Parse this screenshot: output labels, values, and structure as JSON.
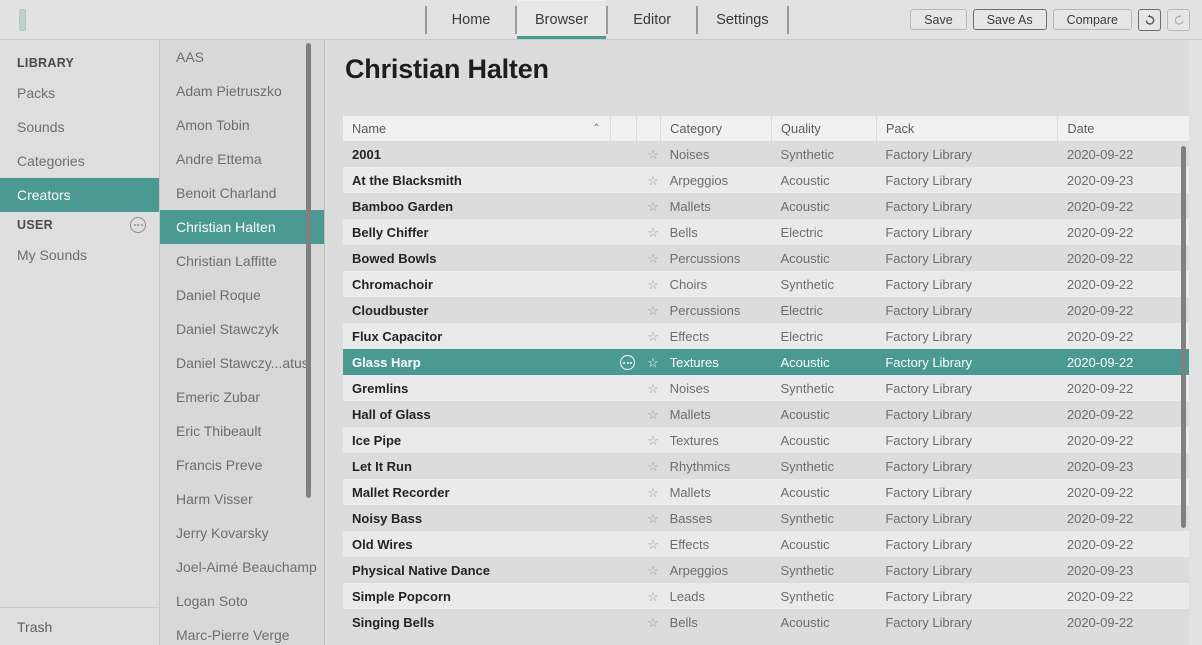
{
  "app": {
    "accent_color": "#4a9a93",
    "logo_name": "app-logo"
  },
  "topbar": {
    "tabs": [
      {
        "label": "Home",
        "active": false
      },
      {
        "label": "Browser",
        "active": true
      },
      {
        "label": "Editor",
        "active": false
      },
      {
        "label": "Settings",
        "active": false
      }
    ],
    "actions": {
      "save_label": "Save",
      "save_as_label": "Save As",
      "compare_label": "Compare",
      "undo_icon": "undo-icon",
      "redo_icon": "redo-icon"
    }
  },
  "sidebar": {
    "sections": [
      {
        "title": "LIBRARY",
        "has_menu": false,
        "items": [
          {
            "label": "Packs",
            "selected": false
          },
          {
            "label": "Sounds",
            "selected": false
          },
          {
            "label": "Categories",
            "selected": false
          },
          {
            "label": "Creators",
            "selected": true
          }
        ]
      },
      {
        "title": "USER",
        "has_menu": true,
        "menu_icon": "more-options-icon",
        "items": [
          {
            "label": "My Sounds",
            "selected": false
          }
        ]
      }
    ],
    "footer": {
      "label": "Trash"
    }
  },
  "creators": {
    "items": [
      {
        "label": "AAS",
        "selected": false
      },
      {
        "label": "Adam Pietruszko",
        "selected": false
      },
      {
        "label": "Amon Tobin",
        "selected": false
      },
      {
        "label": "Andre Ettema",
        "selected": false
      },
      {
        "label": "Benoit Charland",
        "selected": false
      },
      {
        "label": "Christian Halten",
        "selected": true
      },
      {
        "label": "Christian Laffitte",
        "selected": false
      },
      {
        "label": "Daniel Roque",
        "selected": false
      },
      {
        "label": "Daniel Stawczyk",
        "selected": false
      },
      {
        "label": "Daniel Stawczy...atus",
        "selected": false
      },
      {
        "label": "Emeric Zubar",
        "selected": false
      },
      {
        "label": "Eric Thibeault",
        "selected": false
      },
      {
        "label": "Francis Preve",
        "selected": false
      },
      {
        "label": "Harm Visser",
        "selected": false
      },
      {
        "label": "Jerry Kovarsky",
        "selected": false
      },
      {
        "label": "Joel-Aimé Beauchamp",
        "selected": false
      },
      {
        "label": "Logan Soto",
        "selected": false
      },
      {
        "label": "Marc-Pierre Verge",
        "selected": false
      }
    ]
  },
  "main": {
    "title": "Christian Halten",
    "table": {
      "columns": [
        {
          "key": "name",
          "label": "Name",
          "sort": "asc"
        },
        {
          "key": "dots",
          "label": "",
          "sort": null
        },
        {
          "key": "star",
          "label": "",
          "sort": null
        },
        {
          "key": "category",
          "label": "Category",
          "sort": null
        },
        {
          "key": "quality",
          "label": "Quality",
          "sort": null
        },
        {
          "key": "pack",
          "label": "Pack",
          "sort": null
        },
        {
          "key": "date",
          "label": "Date",
          "sort": null
        }
      ],
      "sort_caret_glyph": "⌃",
      "star_glyph": "☆",
      "rows": [
        {
          "name": "2001",
          "category": "Noises",
          "quality": "Synthetic",
          "pack": "Factory Library",
          "date": "2020-09-22",
          "selected": false,
          "starred": false,
          "has_dots": false
        },
        {
          "name": "At the Blacksmith",
          "category": "Arpeggios",
          "quality": "Acoustic",
          "pack": "Factory Library",
          "date": "2020-09-23",
          "selected": false,
          "starred": false,
          "has_dots": false
        },
        {
          "name": "Bamboo Garden",
          "category": "Mallets",
          "quality": "Acoustic",
          "pack": "Factory Library",
          "date": "2020-09-22",
          "selected": false,
          "starred": false,
          "has_dots": false
        },
        {
          "name": "Belly Chiffer",
          "category": "Bells",
          "quality": "Electric",
          "pack": "Factory Library",
          "date": "2020-09-22",
          "selected": false,
          "starred": false,
          "has_dots": false
        },
        {
          "name": "Bowed Bowls",
          "category": "Percussions",
          "quality": "Acoustic",
          "pack": "Factory Library",
          "date": "2020-09-22",
          "selected": false,
          "starred": false,
          "has_dots": false
        },
        {
          "name": "Chromachoir",
          "category": "Choirs",
          "quality": "Synthetic",
          "pack": "Factory Library",
          "date": "2020-09-22",
          "selected": false,
          "starred": false,
          "has_dots": false
        },
        {
          "name": "Cloudbuster",
          "category": "Percussions",
          "quality": "Electric",
          "pack": "Factory Library",
          "date": "2020-09-22",
          "selected": false,
          "starred": false,
          "has_dots": false
        },
        {
          "name": "Flux Capacitor",
          "category": "Effects",
          "quality": "Electric",
          "pack": "Factory Library",
          "date": "2020-09-22",
          "selected": false,
          "starred": false,
          "has_dots": false
        },
        {
          "name": "Glass Harp",
          "category": "Textures",
          "quality": "Acoustic",
          "pack": "Factory Library",
          "date": "2020-09-22",
          "selected": true,
          "starred": false,
          "has_dots": true
        },
        {
          "name": "Gremlins",
          "category": "Noises",
          "quality": "Synthetic",
          "pack": "Factory Library",
          "date": "2020-09-22",
          "selected": false,
          "starred": false,
          "has_dots": false
        },
        {
          "name": "Hall of Glass",
          "category": "Mallets",
          "quality": "Acoustic",
          "pack": "Factory Library",
          "date": "2020-09-22",
          "selected": false,
          "starred": false,
          "has_dots": false
        },
        {
          "name": "Ice Pipe",
          "category": "Textures",
          "quality": "Acoustic",
          "pack": "Factory Library",
          "date": "2020-09-22",
          "selected": false,
          "starred": false,
          "has_dots": false
        },
        {
          "name": "Let It Run",
          "category": "Rhythmics",
          "quality": "Synthetic",
          "pack": "Factory Library",
          "date": "2020-09-23",
          "selected": false,
          "starred": false,
          "has_dots": false
        },
        {
          "name": "Mallet Recorder",
          "category": "Mallets",
          "quality": "Acoustic",
          "pack": "Factory Library",
          "date": "2020-09-22",
          "selected": false,
          "starred": false,
          "has_dots": false
        },
        {
          "name": "Noisy Bass",
          "category": "Basses",
          "quality": "Synthetic",
          "pack": "Factory Library",
          "date": "2020-09-22",
          "selected": false,
          "starred": false,
          "has_dots": false
        },
        {
          "name": "Old Wires",
          "category": "Effects",
          "quality": "Acoustic",
          "pack": "Factory Library",
          "date": "2020-09-22",
          "selected": false,
          "starred": false,
          "has_dots": false
        },
        {
          "name": "Physical Native Dance",
          "category": "Arpeggios",
          "quality": "Synthetic",
          "pack": "Factory Library",
          "date": "2020-09-23",
          "selected": false,
          "starred": false,
          "has_dots": false
        },
        {
          "name": "Simple Popcorn",
          "category": "Leads",
          "quality": "Synthetic",
          "pack": "Factory Library",
          "date": "2020-09-22",
          "selected": false,
          "starred": false,
          "has_dots": false
        },
        {
          "name": "Singing Bells",
          "category": "Bells",
          "quality": "Acoustic",
          "pack": "Factory Library",
          "date": "2020-09-22",
          "selected": false,
          "starred": false,
          "has_dots": false
        }
      ]
    }
  }
}
